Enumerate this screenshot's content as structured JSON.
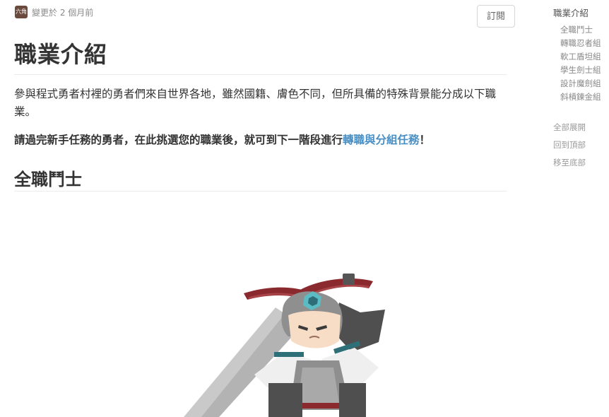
{
  "meta": {
    "avatar_text": "六角",
    "updated": "變更於 2 個月前"
  },
  "subscribe_label": "訂閱",
  "article": {
    "title": "職業介紹",
    "intro": "參與程式勇者村裡的勇者們來自世界各地，雖然國籍、膚色不同，但所具備的特殊背景能分成以下職業。",
    "cta_prefix": "請過完新手任務的勇者，在此挑選您的職業後，就可到下一階段進行",
    "cta_link": "轉職與分組任務",
    "cta_suffix": "！",
    "section1": "全職鬥士"
  },
  "toc": {
    "title": "職業介紹",
    "items": [
      "全職鬥士",
      "轉職忍者組",
      "軟工盾坦組",
      "學生劍士組",
      "設計魔劍組",
      "斜槓鍊金組"
    ],
    "actions": [
      "全部展開",
      "回到頂部",
      "移至底部"
    ]
  },
  "colors": {
    "link": "#4a8fc4",
    "wing": "#8a2a2e",
    "gem": "#5bbcc4",
    "armor": "#8f8f8f"
  },
  "icons": {
    "illustration": "warrior-character-illustration"
  }
}
